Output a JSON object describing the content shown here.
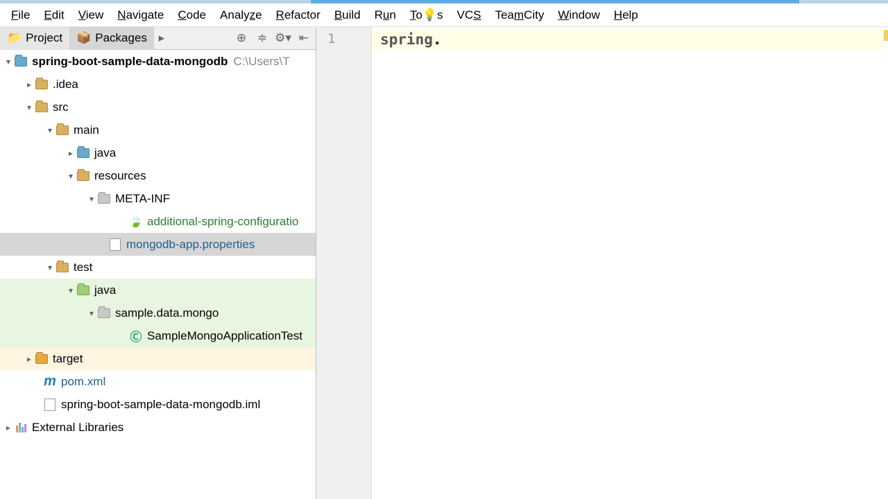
{
  "menu": {
    "file": "File",
    "edit": "Edit",
    "view": "View",
    "navigate": "Navigate",
    "code": "Code",
    "analyze": "Analyze",
    "refactor": "Refactor",
    "build": "Build",
    "run": "Run",
    "tools": "Tools",
    "vcs": "VCS",
    "teamcity": "TeamCity",
    "window": "Window",
    "help": "Help"
  },
  "panel": {
    "tab_project": "Project",
    "tab_packages": "Packages"
  },
  "tree": {
    "root": "spring-boot-sample-data-mongodb",
    "root_path": "C:\\Users\\T",
    "idea": ".idea",
    "src": "src",
    "main": "main",
    "java_main": "java",
    "resources": "resources",
    "metainf": "META-INF",
    "additional_cfg": "additional-spring-configuratio",
    "mongodb_props": "mongodb-app.properties",
    "test": "test",
    "java_test": "java",
    "sample_pkg": "sample.data.mongo",
    "test_class": "SampleMongoApplicationTest",
    "target": "target",
    "pom": "pom.xml",
    "iml": "spring-boot-sample-data-mongodb.iml",
    "ext_libs": "External Libraries"
  },
  "editor": {
    "line_no": "1",
    "code": "spring",
    "dot": "."
  }
}
